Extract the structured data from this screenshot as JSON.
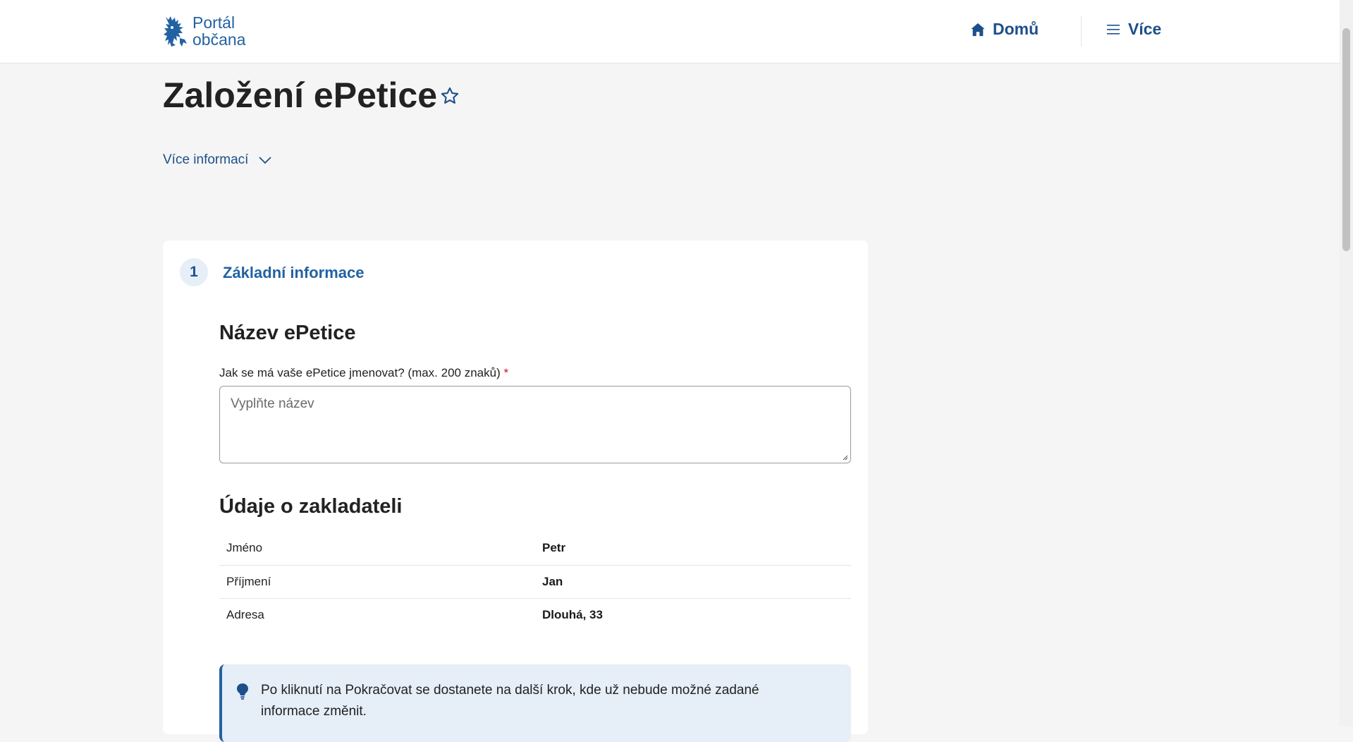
{
  "header": {
    "logo_line1": "Portál",
    "logo_line2": "občana",
    "nav_home": "Domů",
    "nav_more": "Více"
  },
  "page": {
    "title": "Založení ePetice",
    "more_info": "Více informací"
  },
  "step": {
    "number": "1",
    "title": "Základní informace"
  },
  "petition_name": {
    "heading": "Název ePetice",
    "label": "Jak se má vaše ePetice jmenovat? (max. 200 znaků)",
    "required_mark": "*",
    "placeholder": "Vyplňte název",
    "value": ""
  },
  "founder": {
    "heading": "Údaje o zakladateli",
    "rows": [
      {
        "label": "Jméno",
        "value": "Petr"
      },
      {
        "label": "Příjmení",
        "value": "Jan"
      },
      {
        "label": "Adresa",
        "value": "Dlouhá, 33"
      }
    ]
  },
  "notice": {
    "text": "Po kliknutí na Pokračovat se dostanete na další krok, kde už nebude možné zadané informace změnit."
  },
  "icons": {
    "logo": "czech-lion-icon",
    "home": "home-icon",
    "menu": "hamburger-icon",
    "favorite": "star-outline-icon",
    "expand": "chevron-down-icon",
    "tip": "lightbulb-icon"
  },
  "colors": {
    "brand": "#2362a2",
    "nav": "#1d4f8a",
    "background": "#f5f5f5",
    "notice_bg": "#e6eef8",
    "required": "#c8102e"
  }
}
